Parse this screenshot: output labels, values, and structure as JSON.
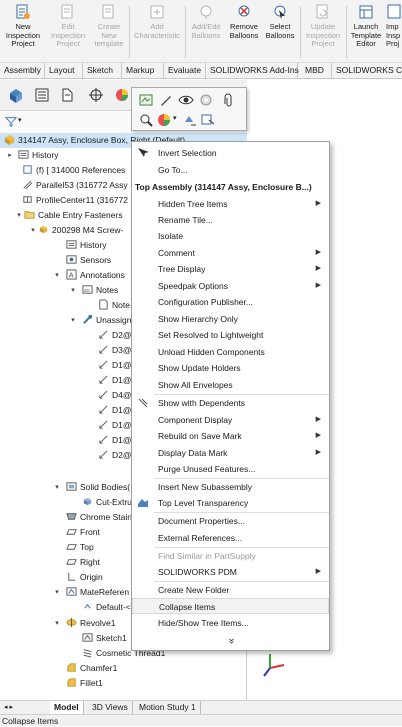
{
  "ribbon": {
    "buttons": [
      {
        "label": "New Inspection Project",
        "lines": [
          "New",
          "Inspection",
          "Project"
        ],
        "disabled": false
      },
      {
        "label": "Edit Inspection Project",
        "lines": [
          "Edit",
          "Inspection",
          "Project"
        ],
        "disabled": true
      },
      {
        "label": "Create New template",
        "lines": [
          "Create",
          "New",
          "template"
        ],
        "disabled": true
      },
      {
        "label": "Add Characteristic",
        "lines": [
          "Add",
          "Characteristic"
        ],
        "disabled": true
      },
      {
        "label": "Add/Edit Balloons",
        "lines": [
          "Add/Edit",
          "Balloons"
        ],
        "disabled": true
      },
      {
        "label": "Remove Balloons",
        "lines": [
          "Remove",
          "Balloons"
        ],
        "disabled": false
      },
      {
        "label": "Select Balloons",
        "lines": [
          "Select",
          "Balloons"
        ],
        "disabled": false
      },
      {
        "label": "Update Inspection Project",
        "lines": [
          "Update",
          "Inspection",
          "Project"
        ],
        "disabled": true
      },
      {
        "label": "Launch Template Editor",
        "lines": [
          "Launch",
          "Template",
          "Editor"
        ],
        "disabled": false
      },
      {
        "label": "Imp",
        "lines": [
          "Imp",
          "Insp",
          "Proj"
        ],
        "disabled": false
      }
    ]
  },
  "command_tabs": [
    "Assembly",
    "Layout",
    "Sketch",
    "Markup",
    "Evaluate",
    "SOLIDWORKS Add-Ins",
    "MBD",
    "SOLIDWORKS CA"
  ],
  "tree": {
    "top_item": "314147 Assy, Enclosure Box, Right (Default)",
    "items": [
      {
        "label": "History",
        "icon": "history-icon"
      },
      {
        "label": "(f) [ 314000 References",
        "icon": "reference-icon"
      },
      {
        "label": "Parallel53 (316772 Assy",
        "icon": "mate-icon"
      },
      {
        "label": "ProfileCenter11 (316772",
        "icon": "mate-icon"
      },
      {
        "label": "Cable Entry Fasteners",
        "icon": "folder-icon"
      },
      {
        "label": "200298 M4 Screw-",
        "icon": "part-icon"
      },
      {
        "label": "History",
        "icon": "history-icon"
      },
      {
        "label": "Sensors",
        "icon": "sensor-icon"
      },
      {
        "label": "Annotations",
        "icon": "annotation-icon"
      },
      {
        "label": "Notes",
        "icon": "notes-folder-icon"
      },
      {
        "label": "Note",
        "icon": "note-icon"
      },
      {
        "label": "Unassign",
        "icon": "dimxpert-icon"
      },
      {
        "label": "D2@",
        "icon": "dimension-icon"
      },
      {
        "label": "D3@",
        "icon": "dimension-icon"
      },
      {
        "label": "D1@",
        "icon": "dimension-icon"
      },
      {
        "label": "D1@",
        "icon": "dimension-icon"
      },
      {
        "label": "D4@",
        "icon": "dimension-icon"
      },
      {
        "label": "D1@",
        "icon": "dimension-icon"
      },
      {
        "label": "D1@",
        "icon": "dimension-icon"
      },
      {
        "label": "D1@",
        "icon": "dimension-icon"
      },
      {
        "label": "D2@",
        "icon": "dimension-icon"
      },
      {
        "label": "Solid Bodies(",
        "icon": "solid-bodies-icon"
      },
      {
        "label": "Cut-Extru",
        "icon": "body-icon"
      },
      {
        "label": "Chrome Stain",
        "icon": "material-icon"
      },
      {
        "label": "Front",
        "icon": "plane-icon"
      },
      {
        "label": "Top",
        "icon": "plane-icon"
      },
      {
        "label": "Right",
        "icon": "plane-icon"
      },
      {
        "label": "Origin",
        "icon": "origin-icon"
      },
      {
        "label": "MateReferen",
        "icon": "mate-reference-icon"
      },
      {
        "label": "Default-<",
        "icon": "mate-reference-icon"
      },
      {
        "label": "Revolve1",
        "icon": "revolve-icon"
      },
      {
        "label": "Sketch1",
        "icon": "sketch-icon"
      },
      {
        "label": "Cosmetic Thread1",
        "icon": "thread-icon"
      },
      {
        "label": "Chamfer1",
        "icon": "chamfer-icon"
      },
      {
        "label": "Fillet1",
        "icon": "fillet-icon"
      }
    ]
  },
  "context_menu": {
    "items": [
      {
        "label": "Invert Selection",
        "type": "item",
        "icon": "invert-selection-icon"
      },
      {
        "label": "Go To...",
        "type": "item"
      },
      {
        "label": "Top Assembly (314147 Assy, Enclosure B...)",
        "type": "header"
      },
      {
        "label": "Hidden Tree Items",
        "type": "submenu"
      },
      {
        "label": "Rename Tile...",
        "type": "item"
      },
      {
        "label": "Isolate",
        "type": "item"
      },
      {
        "label": "Comment",
        "type": "submenu"
      },
      {
        "label": "Tree Display",
        "type": "submenu"
      },
      {
        "label": "Speedpak Options",
        "type": "submenu"
      },
      {
        "label": "Configuration Publisher...",
        "type": "item"
      },
      {
        "label": "Show Hierarchy Only",
        "type": "item"
      },
      {
        "label": "Set Resolved to Lightweight",
        "type": "item"
      },
      {
        "label": "Unload Hidden Components",
        "type": "item"
      },
      {
        "label": "Show Update Holders",
        "type": "item"
      },
      {
        "label": "Show All Envelopes",
        "type": "item"
      },
      {
        "label": "Show with Dependents",
        "type": "item",
        "icon": "dependents-icon"
      },
      {
        "label": "Component Display",
        "type": "submenu"
      },
      {
        "label": "Rebuild on Save Mark",
        "type": "submenu"
      },
      {
        "label": "Display Data Mark",
        "type": "submenu"
      },
      {
        "label": "Purge Unused Features...",
        "type": "item"
      },
      {
        "label": "Insert New Subassembly",
        "type": "item"
      },
      {
        "label": "Top Level Transparency",
        "type": "item",
        "icon": "transparency-icon"
      },
      {
        "label": "Document Properties...",
        "type": "item"
      },
      {
        "label": "External References...",
        "type": "item"
      },
      {
        "label": "Find Similar in PartSupply",
        "type": "disabled"
      },
      {
        "label": "SOLIDWORKS PDM",
        "type": "submenu"
      },
      {
        "label": "Create New Folder",
        "type": "item"
      },
      {
        "label": "Collapse Items",
        "type": "highlight"
      },
      {
        "label": "Hide/Show Tree Items...",
        "type": "item"
      },
      {
        "label": "»",
        "type": "more"
      }
    ]
  },
  "bottom_tabs": [
    "Model",
    "3D Views",
    "Motion Study 1"
  ],
  "status_text": "Collapse Items"
}
